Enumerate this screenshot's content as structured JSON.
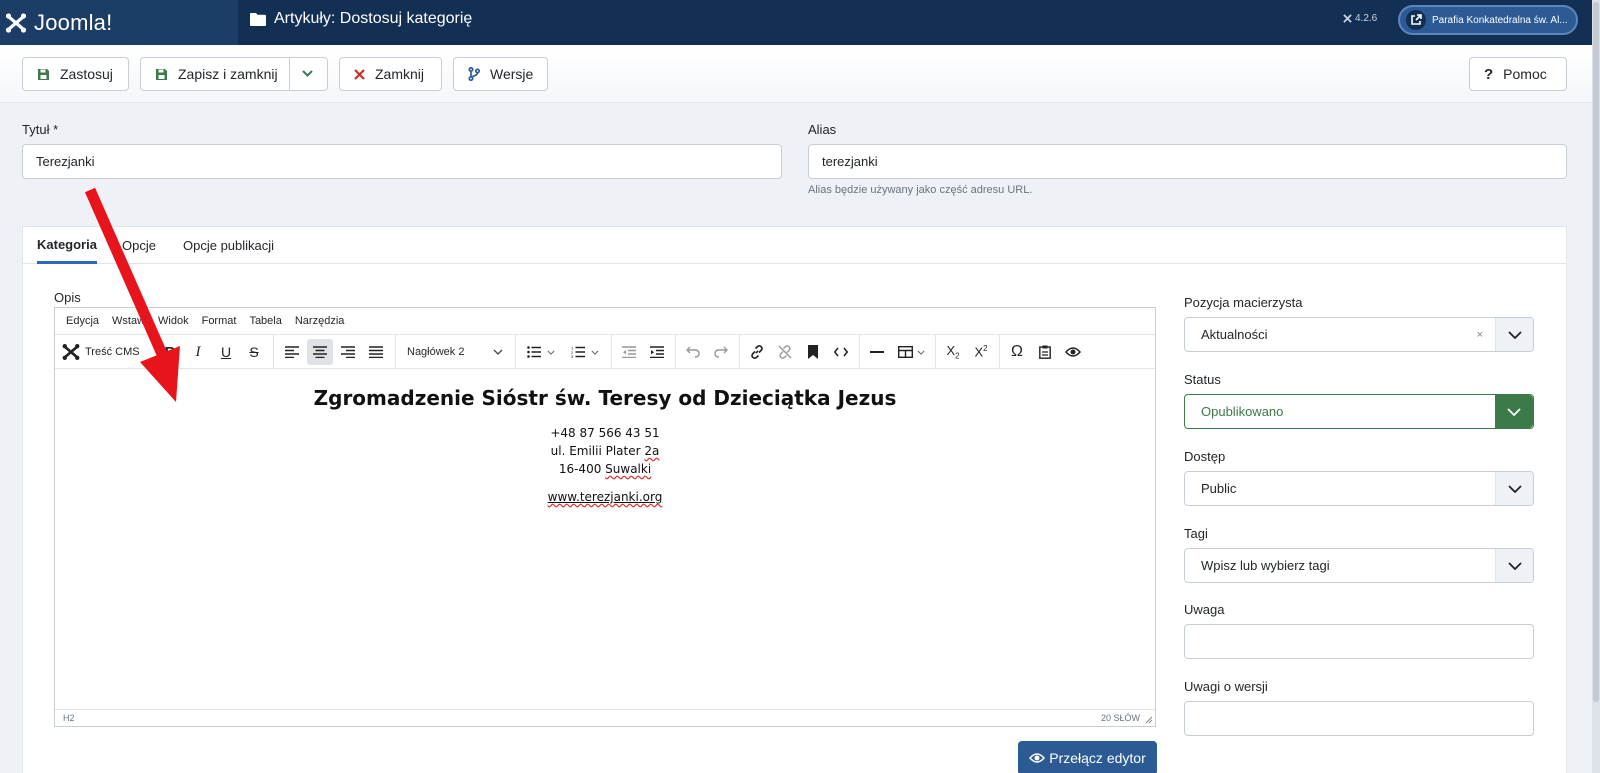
{
  "header": {
    "logo_text": "Joomla!",
    "page_title": "Artykuły: Dostosuj kategorię",
    "version": "4.2.6",
    "site_name": "Parafia Konkatedralna św. Al..."
  },
  "toolbar": {
    "apply": "Zastosuj",
    "save_close": "Zapisz i zamknij",
    "close": "Zamknij",
    "versions": "Wersje",
    "help": "Pomoc"
  },
  "form": {
    "title_label": "Tytuł *",
    "title_value": "Terezjanki",
    "alias_label": "Alias",
    "alias_value": "terezjanki",
    "alias_hint": "Alias będzie używany jako część adresu URL."
  },
  "tabs": [
    "Kategoria",
    "Opcje",
    "Opcje publikacji"
  ],
  "editor": {
    "label": "Opis",
    "menu": [
      "Edycja",
      "Wstaw",
      "Widok",
      "Format",
      "Tabela",
      "Narzędzia"
    ],
    "cms_content": "Treść CMS",
    "block_format": "Nagłówek 2",
    "heading": "Zgromadzenie Sióstr św. Teresy od Dzieciątka Jezus",
    "phone": "+48 87 566 43 51",
    "street_prefix": "ul. Emilii Plater ",
    "street_num": "2a",
    "city_prefix": "16-400 ",
    "city": "Suwalki",
    "website": "www.terezjanki.org",
    "path": "H2",
    "word_count": "20 SŁÓW",
    "toggle_button": "Przełącz edytor"
  },
  "sidebar": {
    "parent_label": "Pozycja macierzysta",
    "parent_value": "Aktualności",
    "status_label": "Status",
    "status_value": "Opublikowano",
    "access_label": "Dostęp",
    "access_value": "Public",
    "tags_label": "Tagi",
    "tags_placeholder": "Wpisz lub wybierz tagi",
    "note_label": "Uwaga",
    "version_note_label": "Uwagi o wersji"
  },
  "colors": {
    "header_bg": "#132f53",
    "primary": "#2c5a95",
    "published_green": "#3d7a4a",
    "annotation_arrow": "#e8141c"
  }
}
